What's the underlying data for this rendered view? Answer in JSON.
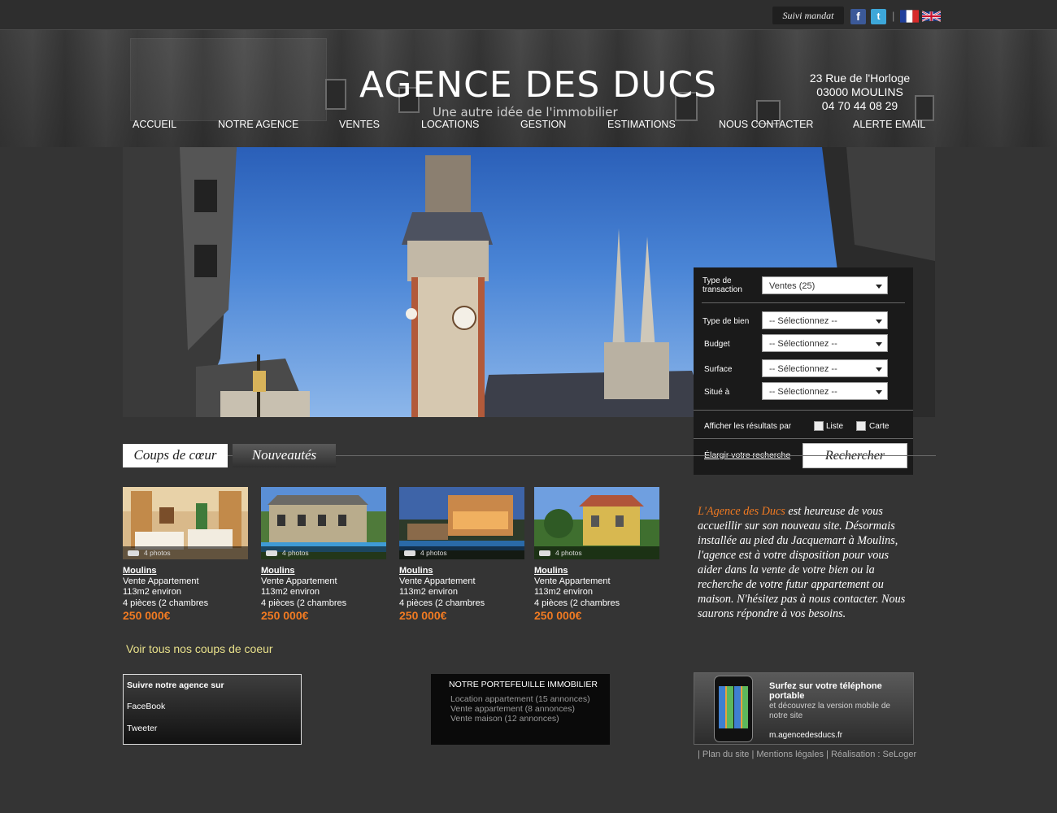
{
  "topbar": {
    "suivi_label": "Suivi mandat",
    "facebook_icon": "facebook-icon",
    "twitter_icon": "twitter-icon",
    "separator": "|",
    "flags": [
      "french-flag-icon",
      "uk-flag-icon"
    ]
  },
  "header": {
    "logo": "AGENCE DES DUCS",
    "tagline": "Une autre idée de l'immobilier",
    "address": [
      "23 Rue de l'Horloge",
      "03000 MOULINS",
      "04 70 44 08 29"
    ]
  },
  "nav": [
    "ACCUEIL",
    "NOTRE AGENCE",
    "VENTES",
    "LOCATIONS",
    "GESTION",
    "ESTIMATIONS",
    "NOUS CONTACTER",
    "ALERTE EMAIL"
  ],
  "search": {
    "transaction_label": "Type de transaction",
    "transaction_value": "Ventes (25)",
    "bien_label": "Type de bien",
    "budget_label": "Budget",
    "surface_label": "Surface",
    "situe_label": "Situé à",
    "placeholder": "-- Sélectionnez --",
    "results_label": "Afficher les résultats par",
    "opt_liste": "Liste",
    "opt_carte": "Carte",
    "elargir": "Élargir votre recherche",
    "submit": "Rechercher"
  },
  "tabs": [
    "Coups de cœur",
    "Nouveautés"
  ],
  "listings": [
    {
      "photos": "4 photos",
      "city": "Moulins",
      "type": "Vente Appartement",
      "surface": "113m2 environ",
      "rooms": "4 pièces (2 chambres",
      "price": "250 000€"
    },
    {
      "photos": "4 photos",
      "city": "Moulins",
      "type": "Vente Appartement",
      "surface": "113m2 environ",
      "rooms": "4 pièces (2 chambres",
      "price": "250 000€"
    },
    {
      "photos": "4 photos",
      "city": "Moulins",
      "type": "Vente Appartement",
      "surface": "113m2 environ",
      "rooms": "4 pièces (2 chambres",
      "price": "250 000€"
    },
    {
      "photos": "4 photos",
      "city": "Moulins",
      "type": "Vente Appartement",
      "surface": "113m2 environ",
      "rooms": "4 pièces (2 chambres",
      "price": "250 000€"
    }
  ],
  "voir_tous": "Voir tous nos coups de coeur",
  "intro": {
    "highlight": "L'Agence des Ducs",
    "text": " est heureuse de vous accueillir sur son nouveau site. Désormais installée au pied du Jacquemart à Moulins, l'agence est à votre disposition pour vous aider dans la vente de votre bien ou la recherche de votre futur appartement ou maison. N'hésitez pas à nous contacter. Nous saurons répondre à vos besoins."
  },
  "follow": {
    "title": "Suivre notre agence sur",
    "facebook": "FaceBook",
    "tweeter": "Tweeter"
  },
  "portfolio": {
    "title": "NOTRE PORTEFEUILLE IMMOBILIER",
    "items": [
      "Location appartement (15 annonces)",
      "Vente appartement (8 annonces)",
      "Vente maison (12 annonces)"
    ]
  },
  "mobile": {
    "title": "Surfez sur votre téléphone portable",
    "desc": "et découvrez la version mobile de notre site",
    "url": "m.agencedesducs.fr"
  },
  "footer": {
    "sep": "|",
    "plan": "Plan du site",
    "mentions": "Mentions légales",
    "realisation": "Réalisation : SeLoger"
  },
  "colors": {
    "background": "#343434",
    "accent": "#f07a22",
    "link_yellow": "#e8e08a"
  }
}
